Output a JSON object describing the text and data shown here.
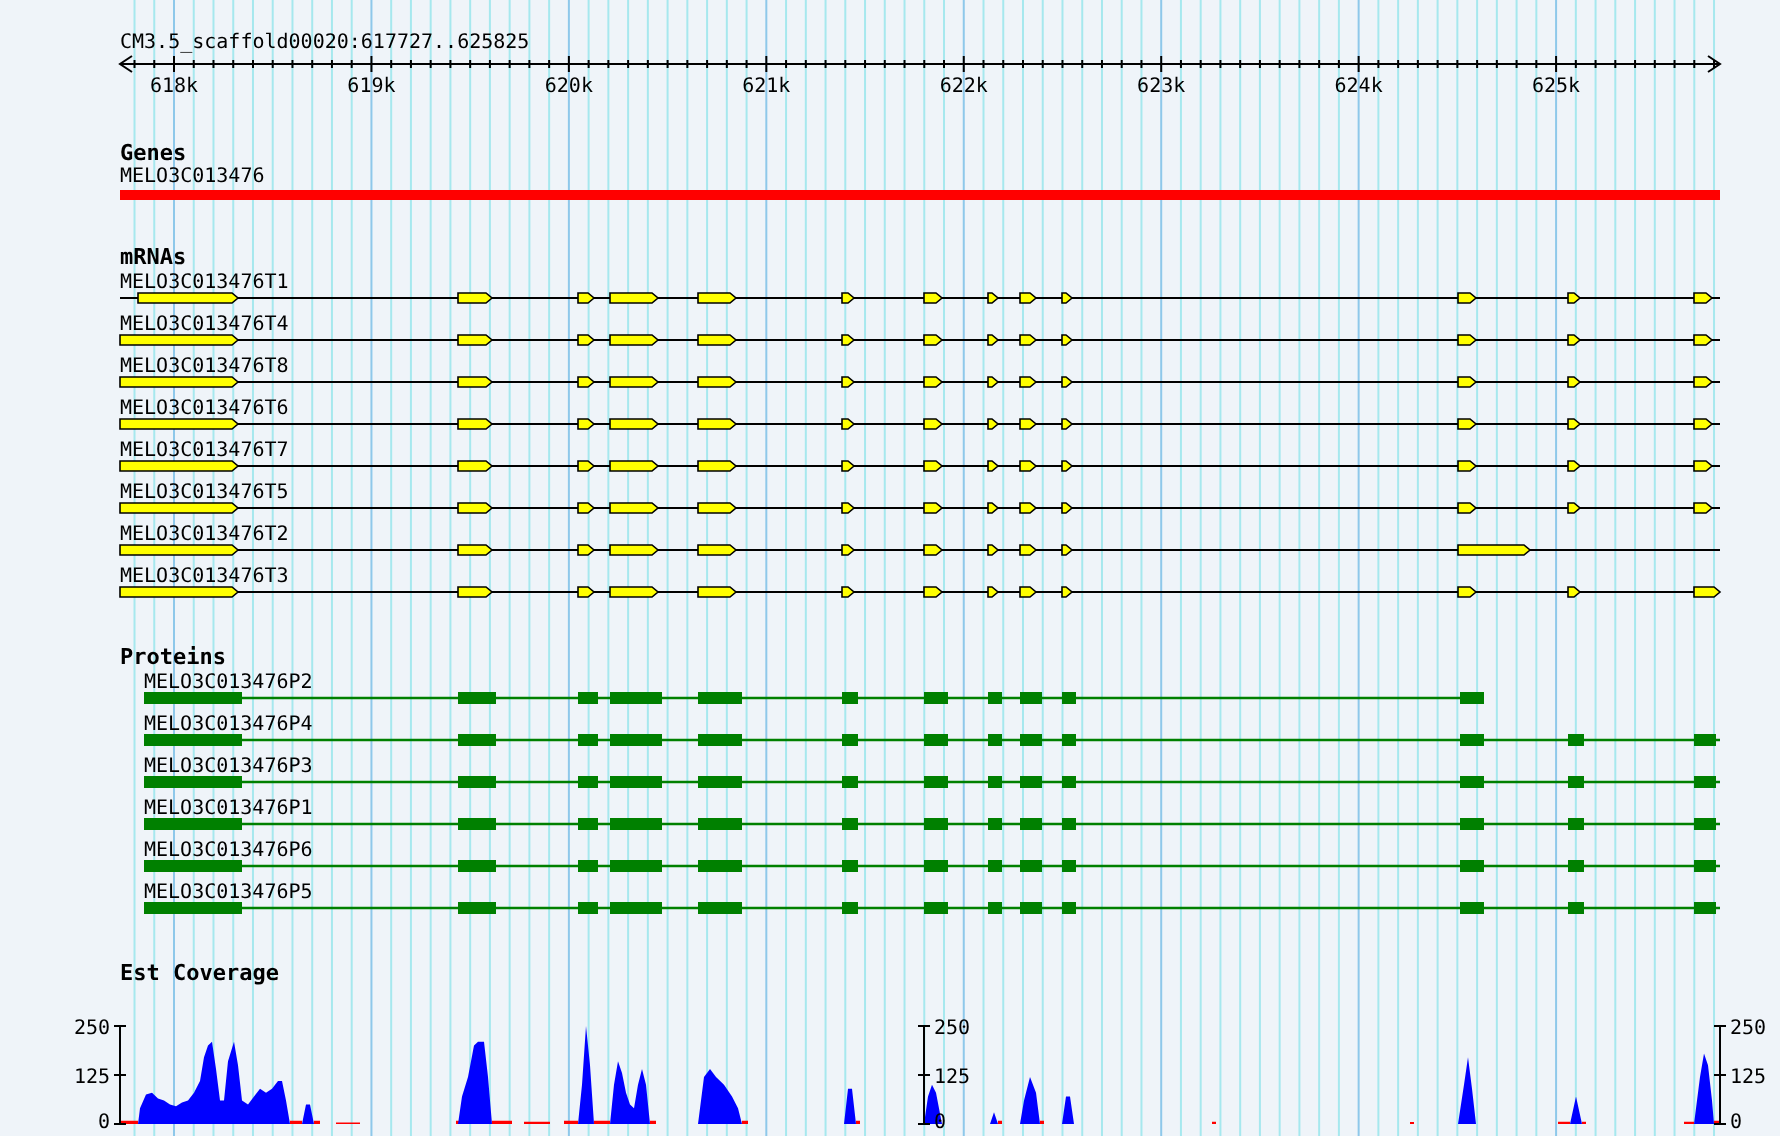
{
  "ruler": {
    "title": "CM3.5_scaffold00020:617727..625825",
    "ticks": [
      "618k",
      "619k",
      "620k",
      "621k",
      "622k",
      "623k",
      "624k",
      "625k"
    ]
  },
  "tracks": [
    {
      "kind": "gene",
      "title": "Genes",
      "features": [
        {
          "name": "MELO3C013476"
        }
      ]
    },
    {
      "kind": "mrna",
      "title": "mRNAs",
      "features": [
        {
          "name": "MELO3C013476T1"
        },
        {
          "name": "MELO3C013476T4"
        },
        {
          "name": "MELO3C013476T8"
        },
        {
          "name": "MELO3C013476T6"
        },
        {
          "name": "MELO3C013476T7"
        },
        {
          "name": "MELO3C013476T5"
        },
        {
          "name": "MELO3C013476T2"
        },
        {
          "name": "MELO3C013476T3"
        }
      ]
    },
    {
      "kind": "protein",
      "title": "Proteins",
      "features": [
        {
          "name": "MELO3C013476P2"
        },
        {
          "name": "MELO3C013476P4"
        },
        {
          "name": "MELO3C013476P3"
        },
        {
          "name": "MELO3C013476P1"
        },
        {
          "name": "MELO3C013476P6"
        },
        {
          "name": "MELO3C013476P5"
        }
      ]
    },
    {
      "kind": "coverage",
      "title": "Est Coverage",
      "axes": [
        {
          "labels": [
            "250",
            "125",
            "0"
          ]
        },
        {
          "labels": [
            "250",
            "125",
            "0"
          ]
        },
        {
          "labels": [
            "250",
            "125",
            "0"
          ]
        }
      ]
    }
  ]
}
